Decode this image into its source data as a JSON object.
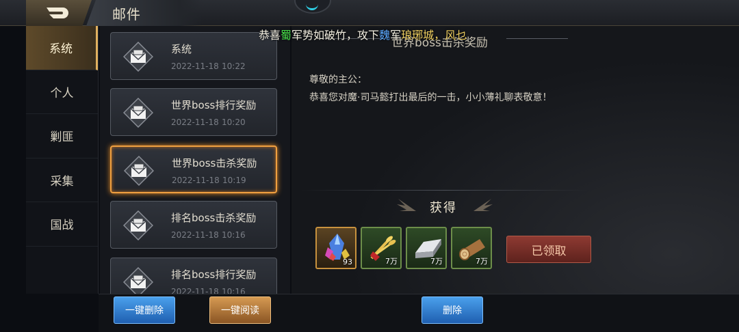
{
  "header": {
    "title": "邮件",
    "back_icon": "back-arrow-icon"
  },
  "nav": {
    "items": [
      {
        "label": "系统",
        "active": true
      },
      {
        "label": "个人",
        "active": false
      },
      {
        "label": "剿匪",
        "active": false
      },
      {
        "label": "采集",
        "active": false
      },
      {
        "label": "国战",
        "active": false
      }
    ]
  },
  "mails": [
    {
      "name": "系统",
      "date": "2022-11-18",
      "time": "10:22",
      "selected": false
    },
    {
      "name": "世界boss排行奖励",
      "date": "2022-11-18",
      "time": "10:20",
      "selected": false
    },
    {
      "name": "世界boss击杀奖励",
      "date": "2022-11-18",
      "time": "10:19",
      "selected": true
    },
    {
      "name": "排名boss击杀奖励",
      "date": "2022-11-18",
      "time": "10:16",
      "selected": false
    },
    {
      "name": "排名boss排行奖励",
      "date": "2022-11-18",
      "time": "10:16",
      "selected": false
    }
  ],
  "marquee": {
    "p1": "恭喜",
    "p2": "蜀",
    "p3": "军势如破竹，攻下",
    "p4": "魏",
    "p5": "军",
    "p6": "琅琊城",
    "p7": "，风乜"
  },
  "detail": {
    "title": "世界boss击杀奖励",
    "greeting": "尊敬的主公：",
    "body": "恭喜您对魔·司马懿打出最后的一击，小小薄礼聊表敬意！",
    "reward_title": "获得",
    "rewards": [
      {
        "icon": "crystal-icon",
        "count": "93",
        "rarity": "gold"
      },
      {
        "icon": "wheat-icon",
        "count": "7万",
        "rarity": "green"
      },
      {
        "icon": "iron-ingot-icon",
        "count": "7万",
        "rarity": "green"
      },
      {
        "icon": "wood-log-icon",
        "count": "7万",
        "rarity": "green"
      }
    ],
    "claimed_label": "已领取"
  },
  "footer": {
    "delete_all_label": "一键删除",
    "read_all_label": "一键阅读",
    "delete_label": "删除"
  },
  "colors": {
    "accent": "#f0a040",
    "shu": "#48e04a",
    "wei": "#5aa8ff",
    "place": "#f0d060"
  }
}
